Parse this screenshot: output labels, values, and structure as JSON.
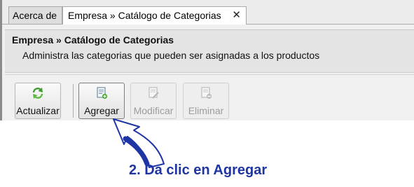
{
  "tabs": [
    {
      "label": "Acerca de",
      "active": false
    },
    {
      "label": "Empresa » Catálogo de Categorias",
      "active": true,
      "close_glyph": "✕"
    }
  ],
  "header": {
    "title": "Empresa » Catálogo de Categorias",
    "description": "Administra las categorias que pueden ser asignadas a los productos"
  },
  "toolbar": {
    "buttons": [
      {
        "label": "Actualizar",
        "icon": "refresh-icon",
        "enabled": true
      },
      {
        "label": "Agregar",
        "icon": "add-document-icon",
        "enabled": true
      },
      {
        "label": "Modificar",
        "icon": "edit-document-icon",
        "enabled": false
      },
      {
        "label": "Eliminar",
        "icon": "delete-document-icon",
        "enabled": false
      }
    ]
  },
  "annotation": {
    "text": "2. Da clic en Agregar",
    "color": "#1f35a3"
  }
}
